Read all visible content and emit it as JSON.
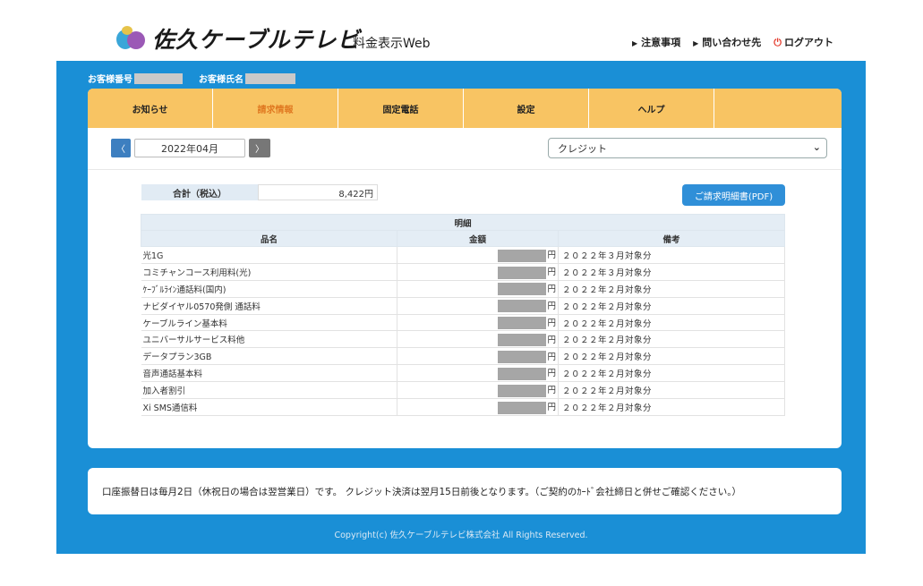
{
  "header": {
    "logo_text": "佐久ケーブルテレビ",
    "service_title": "料金表示Web",
    "links": [
      "注意事項",
      "問い合わせ先"
    ],
    "logout": "ログアウト"
  },
  "customer": {
    "number_label": "お客様番号",
    "name_label": "お客様氏名"
  },
  "tabs": [
    "お知らせ",
    "請求情報",
    "固定電話",
    "設定",
    "ヘルプ",
    ""
  ],
  "nav": {
    "prev": "〈",
    "month": "2022年04月",
    "next": "〉",
    "payment_method": "クレジット"
  },
  "summary": {
    "total_label": "合計（税込）",
    "total_value": "8,422円",
    "pdf_button": "ご請求明細書(PDF)"
  },
  "detail_table": {
    "caption": "明細",
    "headers": [
      "品名",
      "金額",
      "備考"
    ],
    "unit": "円",
    "rows": [
      {
        "name": "光1G",
        "note": "２０２２年３月対象分"
      },
      {
        "name": "コミチャンコース利用料(光)",
        "note": "２０２２年３月対象分"
      },
      {
        "name": "ｹｰﾌﾞﾙﾗｲﾝ通話料(国内)",
        "note": "２０２２年２月対象分"
      },
      {
        "name": "ナビダイヤル0570発側 通話料",
        "note": "２０２２年２月対象分"
      },
      {
        "name": "ケーブルライン基本料",
        "note": "２０２２年２月対象分"
      },
      {
        "name": "ユニバーサルサービス料他",
        "note": "２０２２年２月対象分"
      },
      {
        "name": "データプラン3GB",
        "note": "２０２２年２月対象分"
      },
      {
        "name": "音声通話基本料",
        "note": "２０２２年２月対象分"
      },
      {
        "name": "加入者割引",
        "note": "２０２２年２月対象分"
      },
      {
        "name": "Xi SMS通信料",
        "note": "２０２２年２月対象分"
      }
    ]
  },
  "notice": "口座振替日は毎月2日（休祝日の場合は翌営業日）です。 クレジット決済は翌月15日前後となります。（ご契約のｶｰﾄﾞ会社締日と併せご確認ください。）",
  "copyright": "Copyright(c) 佐久ケーブルテレビ株式会社 All Rights Reserved.",
  "colors": {
    "band": "#1a8fd6",
    "tabs": "#f8c463",
    "active_tab": "#e07a22",
    "button": "#2f8fd8"
  }
}
